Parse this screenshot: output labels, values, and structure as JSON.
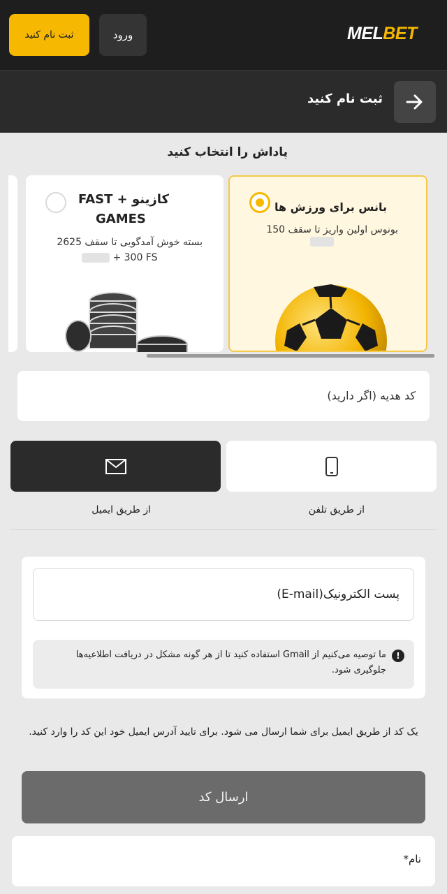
{
  "header": {
    "logo_part1": "MEL",
    "logo_part2": "BET",
    "login_label": "ورود",
    "register_label": "ثبت نام کنید",
    "accent_color": "#f6b800"
  },
  "subheader": {
    "title": "ثبت نام کنید",
    "back_icon": "arrow-right-icon"
  },
  "bonus": {
    "heading": "پاداش را انتخاب کنید",
    "options": [
      {
        "title": "بانس برای ورزش ها",
        "desc": "بونوس اولین واریز تا سقف 150",
        "selected": true,
        "image": "soccer-ball"
      },
      {
        "title_line1": "کازینو + FAST",
        "title_line2": "GAMES",
        "desc_line1": "بسته خوش آمدگویی تا سقف 2625",
        "desc_line2": "+ 300 FS",
        "selected": false,
        "image": "casino-chips"
      }
    ]
  },
  "promo": {
    "placeholder": "کد هدیه (اگر دارید)"
  },
  "methods": {
    "phone_label": "از طریق تلفن",
    "email_label": "از طریق ایمیل",
    "phone_icon": "phone-icon",
    "email_icon": "envelope-icon",
    "active": "email"
  },
  "form": {
    "email_placeholder": "پست الکترونیک(E-mail)",
    "notice": "ما توصیه می‌کنیم از Gmail استفاده کنید تا از هر گونه مشکل در دریافت اطلاعیه‌ها جلوگیری شود.",
    "notice_icon": "exclamation-icon",
    "info": "یک کد از طریق ایمیل برای شما ارسال می شود. برای تایید آدرس ایمیل خود این کد را وارد کنید.",
    "send_label": "ارسال کد",
    "name_placeholder": "نام*"
  }
}
